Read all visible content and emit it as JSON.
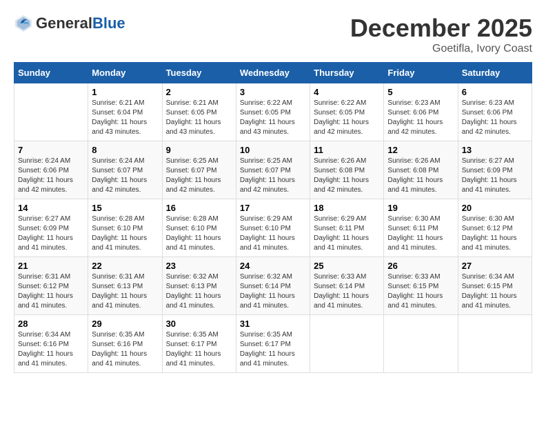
{
  "header": {
    "logo_line1": "General",
    "logo_line2": "Blue",
    "month": "December 2025",
    "location": "Goetifla, Ivory Coast"
  },
  "days_of_week": [
    "Sunday",
    "Monday",
    "Tuesday",
    "Wednesday",
    "Thursday",
    "Friday",
    "Saturday"
  ],
  "weeks": [
    [
      {
        "day": "",
        "sunrise": "",
        "sunset": "",
        "daylight": ""
      },
      {
        "day": "1",
        "sunrise": "Sunrise: 6:21 AM",
        "sunset": "Sunset: 6:04 PM",
        "daylight": "Daylight: 11 hours and 43 minutes."
      },
      {
        "day": "2",
        "sunrise": "Sunrise: 6:21 AM",
        "sunset": "Sunset: 6:05 PM",
        "daylight": "Daylight: 11 hours and 43 minutes."
      },
      {
        "day": "3",
        "sunrise": "Sunrise: 6:22 AM",
        "sunset": "Sunset: 6:05 PM",
        "daylight": "Daylight: 11 hours and 43 minutes."
      },
      {
        "day": "4",
        "sunrise": "Sunrise: 6:22 AM",
        "sunset": "Sunset: 6:05 PM",
        "daylight": "Daylight: 11 hours and 42 minutes."
      },
      {
        "day": "5",
        "sunrise": "Sunrise: 6:23 AM",
        "sunset": "Sunset: 6:06 PM",
        "daylight": "Daylight: 11 hours and 42 minutes."
      },
      {
        "day": "6",
        "sunrise": "Sunrise: 6:23 AM",
        "sunset": "Sunset: 6:06 PM",
        "daylight": "Daylight: 11 hours and 42 minutes."
      }
    ],
    [
      {
        "day": "7",
        "sunrise": "Sunrise: 6:24 AM",
        "sunset": "Sunset: 6:06 PM",
        "daylight": "Daylight: 11 hours and 42 minutes."
      },
      {
        "day": "8",
        "sunrise": "Sunrise: 6:24 AM",
        "sunset": "Sunset: 6:07 PM",
        "daylight": "Daylight: 11 hours and 42 minutes."
      },
      {
        "day": "9",
        "sunrise": "Sunrise: 6:25 AM",
        "sunset": "Sunset: 6:07 PM",
        "daylight": "Daylight: 11 hours and 42 minutes."
      },
      {
        "day": "10",
        "sunrise": "Sunrise: 6:25 AM",
        "sunset": "Sunset: 6:07 PM",
        "daylight": "Daylight: 11 hours and 42 minutes."
      },
      {
        "day": "11",
        "sunrise": "Sunrise: 6:26 AM",
        "sunset": "Sunset: 6:08 PM",
        "daylight": "Daylight: 11 hours and 42 minutes."
      },
      {
        "day": "12",
        "sunrise": "Sunrise: 6:26 AM",
        "sunset": "Sunset: 6:08 PM",
        "daylight": "Daylight: 11 hours and 41 minutes."
      },
      {
        "day": "13",
        "sunrise": "Sunrise: 6:27 AM",
        "sunset": "Sunset: 6:09 PM",
        "daylight": "Daylight: 11 hours and 41 minutes."
      }
    ],
    [
      {
        "day": "14",
        "sunrise": "Sunrise: 6:27 AM",
        "sunset": "Sunset: 6:09 PM",
        "daylight": "Daylight: 11 hours and 41 minutes."
      },
      {
        "day": "15",
        "sunrise": "Sunrise: 6:28 AM",
        "sunset": "Sunset: 6:10 PM",
        "daylight": "Daylight: 11 hours and 41 minutes."
      },
      {
        "day": "16",
        "sunrise": "Sunrise: 6:28 AM",
        "sunset": "Sunset: 6:10 PM",
        "daylight": "Daylight: 11 hours and 41 minutes."
      },
      {
        "day": "17",
        "sunrise": "Sunrise: 6:29 AM",
        "sunset": "Sunset: 6:10 PM",
        "daylight": "Daylight: 11 hours and 41 minutes."
      },
      {
        "day": "18",
        "sunrise": "Sunrise: 6:29 AM",
        "sunset": "Sunset: 6:11 PM",
        "daylight": "Daylight: 11 hours and 41 minutes."
      },
      {
        "day": "19",
        "sunrise": "Sunrise: 6:30 AM",
        "sunset": "Sunset: 6:11 PM",
        "daylight": "Daylight: 11 hours and 41 minutes."
      },
      {
        "day": "20",
        "sunrise": "Sunrise: 6:30 AM",
        "sunset": "Sunset: 6:12 PM",
        "daylight": "Daylight: 11 hours and 41 minutes."
      }
    ],
    [
      {
        "day": "21",
        "sunrise": "Sunrise: 6:31 AM",
        "sunset": "Sunset: 6:12 PM",
        "daylight": "Daylight: 11 hours and 41 minutes."
      },
      {
        "day": "22",
        "sunrise": "Sunrise: 6:31 AM",
        "sunset": "Sunset: 6:13 PM",
        "daylight": "Daylight: 11 hours and 41 minutes."
      },
      {
        "day": "23",
        "sunrise": "Sunrise: 6:32 AM",
        "sunset": "Sunset: 6:13 PM",
        "daylight": "Daylight: 11 hours and 41 minutes."
      },
      {
        "day": "24",
        "sunrise": "Sunrise: 6:32 AM",
        "sunset": "Sunset: 6:14 PM",
        "daylight": "Daylight: 11 hours and 41 minutes."
      },
      {
        "day": "25",
        "sunrise": "Sunrise: 6:33 AM",
        "sunset": "Sunset: 6:14 PM",
        "daylight": "Daylight: 11 hours and 41 minutes."
      },
      {
        "day": "26",
        "sunrise": "Sunrise: 6:33 AM",
        "sunset": "Sunset: 6:15 PM",
        "daylight": "Daylight: 11 hours and 41 minutes."
      },
      {
        "day": "27",
        "sunrise": "Sunrise: 6:34 AM",
        "sunset": "Sunset: 6:15 PM",
        "daylight": "Daylight: 11 hours and 41 minutes."
      }
    ],
    [
      {
        "day": "28",
        "sunrise": "Sunrise: 6:34 AM",
        "sunset": "Sunset: 6:16 PM",
        "daylight": "Daylight: 11 hours and 41 minutes."
      },
      {
        "day": "29",
        "sunrise": "Sunrise: 6:35 AM",
        "sunset": "Sunset: 6:16 PM",
        "daylight": "Daylight: 11 hours and 41 minutes."
      },
      {
        "day": "30",
        "sunrise": "Sunrise: 6:35 AM",
        "sunset": "Sunset: 6:17 PM",
        "daylight": "Daylight: 11 hours and 41 minutes."
      },
      {
        "day": "31",
        "sunrise": "Sunrise: 6:35 AM",
        "sunset": "Sunset: 6:17 PM",
        "daylight": "Daylight: 11 hours and 41 minutes."
      },
      {
        "day": "",
        "sunrise": "",
        "sunset": "",
        "daylight": ""
      },
      {
        "day": "",
        "sunrise": "",
        "sunset": "",
        "daylight": ""
      },
      {
        "day": "",
        "sunrise": "",
        "sunset": "",
        "daylight": ""
      }
    ]
  ]
}
